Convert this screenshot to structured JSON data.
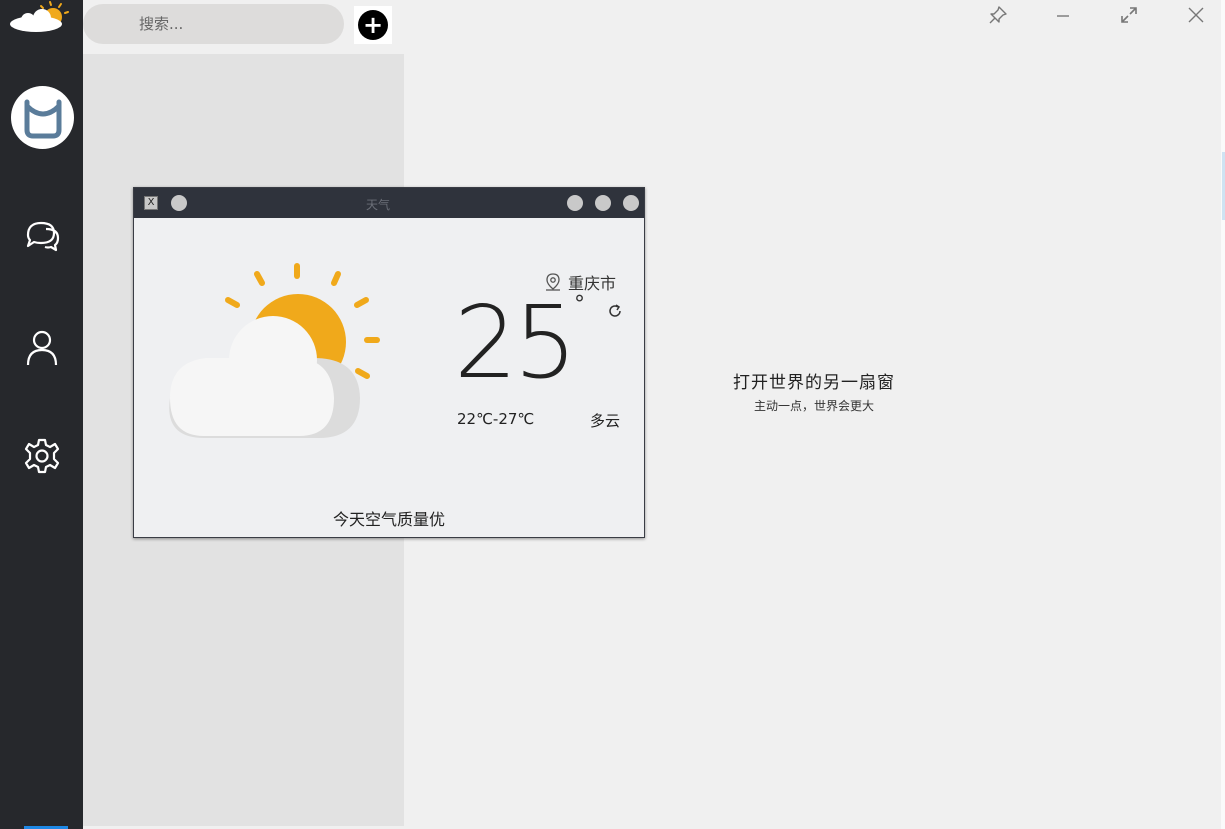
{
  "search": {
    "placeholder": "搜索..."
  },
  "add_button": {
    "label": "+"
  },
  "welcome": {
    "title": "打开世界的另一扇窗",
    "subtitle": "主动一点，世界会更大"
  },
  "weather_window": {
    "title": "天气",
    "city": "重庆市",
    "temperature": "25",
    "degree_symbol": "°",
    "range": "22℃-27℃",
    "condition": "多云",
    "air_quality": "今天空气质量优"
  },
  "sidebar": {
    "items": [
      {
        "icon": "chat-icon"
      },
      {
        "icon": "user-icon"
      },
      {
        "icon": "settings-icon"
      }
    ]
  },
  "colors": {
    "sidebar_bg": "#26282c",
    "accent_sun": "#f0a91b",
    "titlebar_bg": "#2f333c",
    "avatar_border": "#5a7c9a"
  }
}
